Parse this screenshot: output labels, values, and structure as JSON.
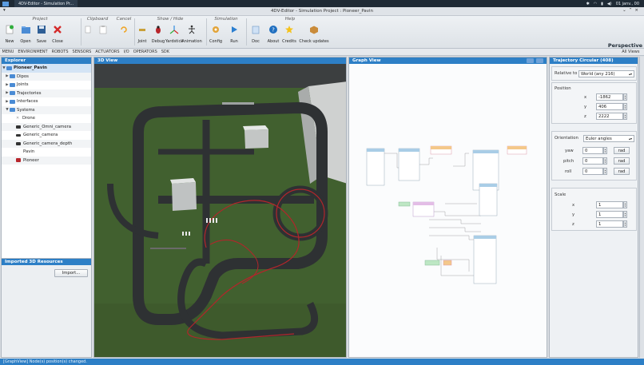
{
  "os": {
    "taskbar_item": "4DV-Editor - Simulation Pr...",
    "clock": "01 janv., 00"
  },
  "window": {
    "title": "4DV-Editor - Simulation Project : Pioneer_Pavin"
  },
  "ribbon": {
    "groups": {
      "project": "Project",
      "clipboard": "Clipboard",
      "cancel": "Cancel",
      "show_hide": "Show / Hide",
      "simulation": "Simulation",
      "help": "Help"
    },
    "tools": {
      "new": "New",
      "open": "Open",
      "save": "Save",
      "close": "Close",
      "joint": "Joint",
      "debug": "Debug",
      "yardstick": "Yardstick",
      "animation": "Animation",
      "config": "Config",
      "run": "Run",
      "doc": "Doc",
      "about": "About",
      "credits": "Credits",
      "check_updates": "Check updates"
    },
    "perspective": "Perspective"
  },
  "tabs": [
    "MENU",
    "ENVIRONMENT",
    "ROBOTS",
    "SENSORS",
    "ACTUATORS",
    "I/O",
    "OPERATORS",
    "SDK"
  ],
  "all_views": "All Views",
  "explorer": {
    "title": "Explorer",
    "items": [
      {
        "label": "Pioneer_Pavin"
      },
      {
        "label": "Dipos"
      },
      {
        "label": "Joints"
      },
      {
        "label": "Trajectories"
      },
      {
        "label": "Interfaces"
      },
      {
        "label": "Systems"
      },
      {
        "label": "Drone"
      },
      {
        "label": "Generic_Omni_camera"
      },
      {
        "label": "Generic_camera"
      },
      {
        "label": "Generic_camera_depth"
      },
      {
        "label": "Pavin"
      },
      {
        "label": "Pioneer"
      }
    ]
  },
  "imported": {
    "title": "Imported 3D Resources",
    "import_button": "Import..."
  },
  "view3d": {
    "title": "3D View"
  },
  "graph": {
    "title": "Graph View"
  },
  "properties": {
    "title": "Trajectory Circular (408)",
    "relative_to_label": "Relative to :",
    "relative_to_value": "World (any 216)",
    "position_label": "Position",
    "x_label": "x",
    "x_value": "-1862",
    "y_label": "y",
    "y_value": "406",
    "z_label": "z",
    "z_value": "2222",
    "orientation_label": "Orientation",
    "orientation_mode": "Euler angles",
    "yaw_label": "yaw",
    "yaw_value": "0",
    "pitch_label": "pitch",
    "pitch_value": "0",
    "roll_label": "roll",
    "roll_value": "0",
    "rad_label": "rad",
    "scale_label": "Scale",
    "sx_label": "x",
    "sx_value": "1",
    "sy_label": "y",
    "sy_value": "1",
    "sz_label": "z",
    "sz_value": "1"
  },
  "status": "[GraphView] Node(s) position(s) changed."
}
